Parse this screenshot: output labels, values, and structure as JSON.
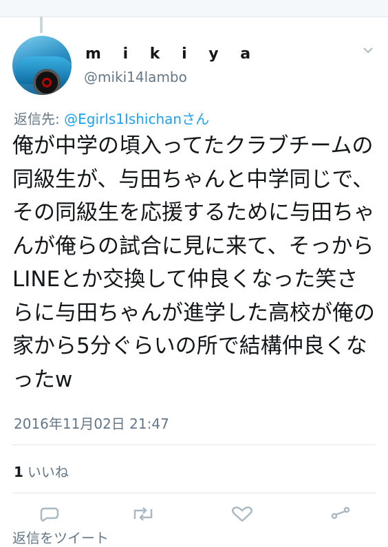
{
  "tweet": {
    "display_name": "m i k i y a",
    "handle": "@miki14lambo",
    "reply_label": "返信先: ",
    "reply_target": "@Egirls1Ishichanさん",
    "text": "俺が中学の頃入ってたクラブチームの同級生が、与田ちゃんと中学同じで、その同級生を応援するために与田ちゃんが俺らの試合に見に来て、そっからLINEとか交換して仲良くなった笑さらに与田ちゃんが進学した高校が俺の家から5分ぐらいの所で結構仲良くなったw",
    "timestamp": "2016年11月02日 21:47",
    "like_count": "1",
    "like_label": "いいね"
  },
  "footer": {
    "cut_text": "返信をツイート"
  },
  "icons": {
    "more": "chevron-down-icon",
    "reply": "reply-icon",
    "retweet": "retweet-icon",
    "like": "heart-icon",
    "share": "share-icon"
  },
  "colors": {
    "link": "#1da1f2",
    "secondary_text": "#657786",
    "divider": "#e1e8ed"
  }
}
